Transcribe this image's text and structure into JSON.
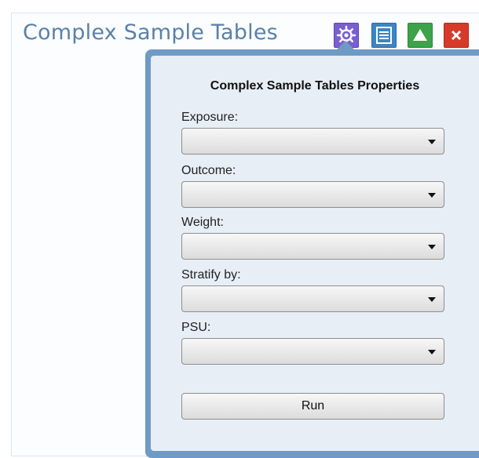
{
  "gadget": {
    "title": "Complex Sample Tables",
    "toolbar": {
      "settings_icon": "gear-icon",
      "list_icon": "list-icon",
      "maximize_icon": "triangle-up-icon",
      "close_icon": "close-x-icon",
      "close_glyph": "×"
    }
  },
  "properties": {
    "heading": "Complex Sample Tables Properties",
    "fields": [
      {
        "label": "Exposure:",
        "value": ""
      },
      {
        "label": "Outcome:",
        "value": ""
      },
      {
        "label": "Weight:",
        "value": ""
      },
      {
        "label": "Stratify by:",
        "value": ""
      },
      {
        "label": "PSU:",
        "value": ""
      }
    ],
    "run_label": "Run"
  },
  "colors": {
    "title": "#5b80a8",
    "panel_border": "#6f9ac6",
    "panel_bg": "#e7eef6",
    "settings_button": "#7a5fd1",
    "list_button": "#3b86c4",
    "maximize_button": "#3da24a",
    "close_button": "#d73a2a"
  }
}
